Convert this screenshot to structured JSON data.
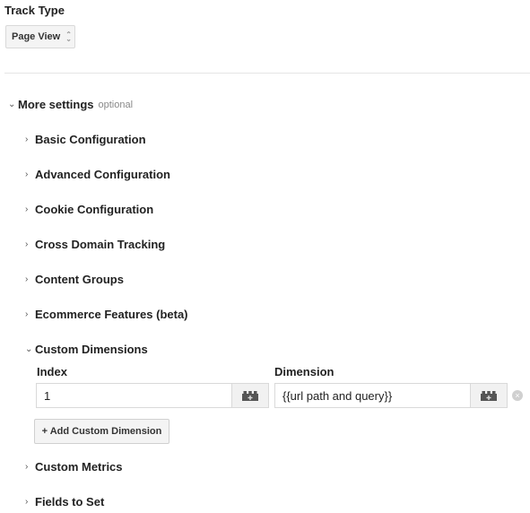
{
  "track_type": {
    "label": "Track Type",
    "selected": "Page View"
  },
  "more_settings": {
    "label": "More settings",
    "optional": "optional",
    "sections": [
      {
        "label": "Basic Configuration",
        "expanded": false
      },
      {
        "label": "Advanced Configuration",
        "expanded": false
      },
      {
        "label": "Cookie Configuration",
        "expanded": false
      },
      {
        "label": "Cross Domain Tracking",
        "expanded": false
      },
      {
        "label": "Content Groups",
        "expanded": false
      },
      {
        "label": "Ecommerce Features (beta)",
        "expanded": false
      },
      {
        "label": "Custom Dimensions",
        "expanded": true
      },
      {
        "label": "Custom Metrics",
        "expanded": false
      },
      {
        "label": "Fields to Set",
        "expanded": false
      }
    ]
  },
  "custom_dimensions": {
    "index_header": "Index",
    "dimension_header": "Dimension",
    "rows": [
      {
        "index": "1",
        "dimension": "{{url path and query}}"
      }
    ],
    "add_button": "+ Add Custom Dimension"
  },
  "icons": {
    "chevron_right": "›",
    "chevron_down": "⌄",
    "variable": "lego-brick-icon",
    "remove": "×"
  }
}
